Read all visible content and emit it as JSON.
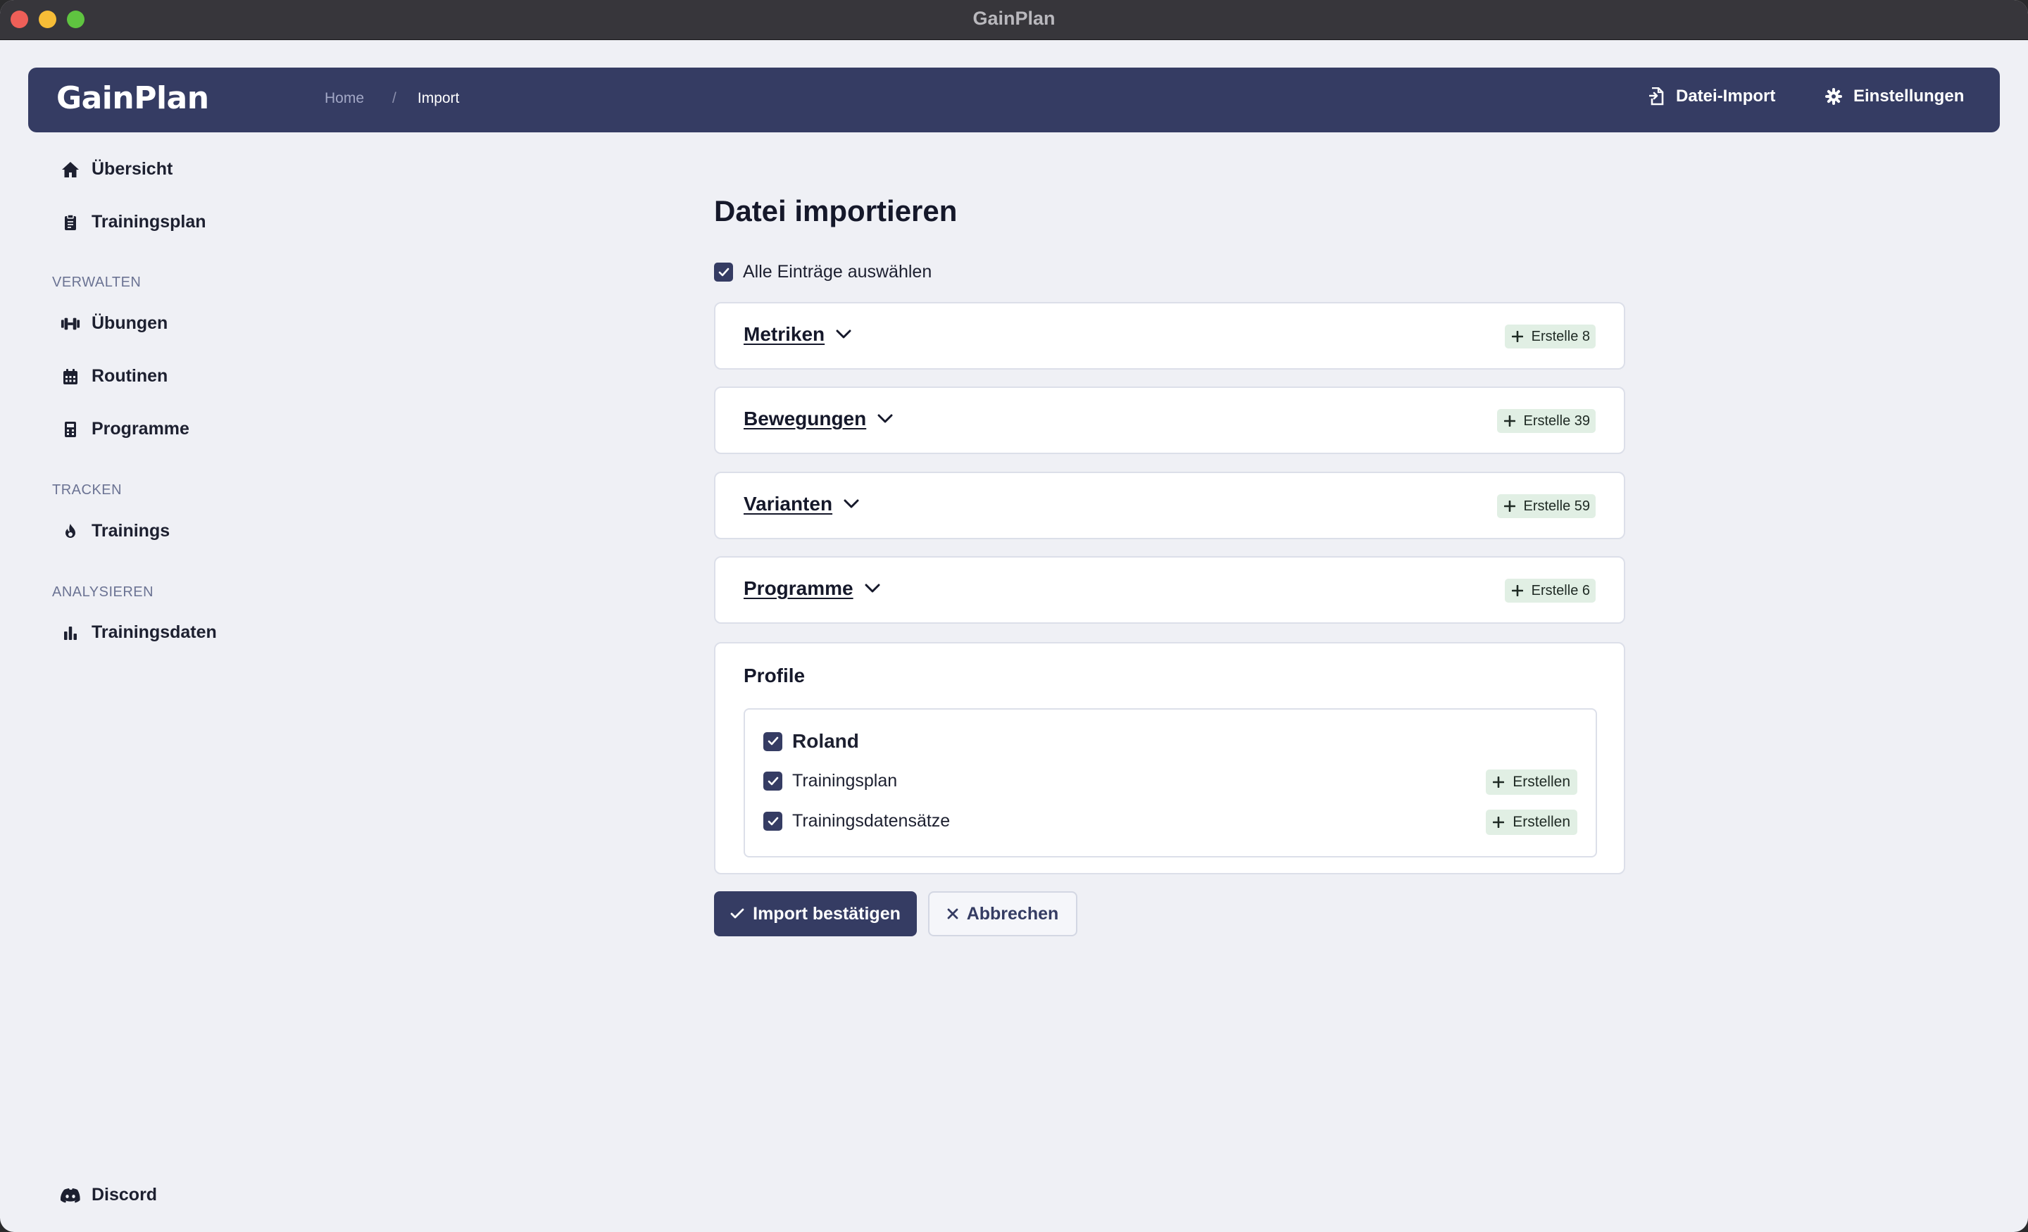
{
  "window": {
    "title": "GainPlan"
  },
  "navbar": {
    "brand": "GainPlan",
    "breadcrumb": {
      "home": "Home",
      "separator": "/",
      "current": "Import"
    },
    "actions": {
      "import": "Datei-Import",
      "settings": "Einstellungen"
    }
  },
  "sidebar": {
    "top": [
      {
        "label": "Übersicht",
        "icon": "home-icon"
      },
      {
        "label": "Trainingsplan",
        "icon": "clipboard-icon"
      }
    ],
    "manage_heading": "VERWALTEN",
    "manage": [
      {
        "label": "Übungen",
        "icon": "dumbbell-icon"
      },
      {
        "label": "Routinen",
        "icon": "calendar-icon"
      },
      {
        "label": "Programme",
        "icon": "calculator-icon"
      }
    ],
    "track_heading": "TRACKEN",
    "track": [
      {
        "label": "Trainings",
        "icon": "flame-icon"
      }
    ],
    "analyze_heading": "ANALYSIEREN",
    "analyze": [
      {
        "label": "Trainingsdaten",
        "icon": "bar-chart-icon"
      }
    ],
    "footer": {
      "label": "Discord",
      "icon": "discord-icon"
    }
  },
  "main": {
    "title": "Datei importieren",
    "select_all": {
      "label": "Alle Einträge auswählen",
      "checked": true
    },
    "sections": [
      {
        "title": "Metriken",
        "badge": "Erstelle 8"
      },
      {
        "title": "Bewegungen",
        "badge": "Erstelle 39"
      },
      {
        "title": "Varianten",
        "badge": "Erstelle 59"
      },
      {
        "title": "Programme",
        "badge": "Erstelle 6"
      }
    ],
    "profiles": {
      "title": "Profile",
      "user": {
        "name": "Roland",
        "checked": true
      },
      "rows": [
        {
          "label": "Trainingsplan",
          "badge": "Erstellen",
          "checked": true
        },
        {
          "label": "Trainingsdatensätze",
          "badge": "Erstellen",
          "checked": true
        }
      ]
    },
    "buttons": {
      "confirm": "Import bestätigen",
      "cancel": "Abbrechen"
    }
  },
  "colors": {
    "primary": "#353c63",
    "background": "#eff0f5",
    "badge_bg": "#e1efe4"
  }
}
